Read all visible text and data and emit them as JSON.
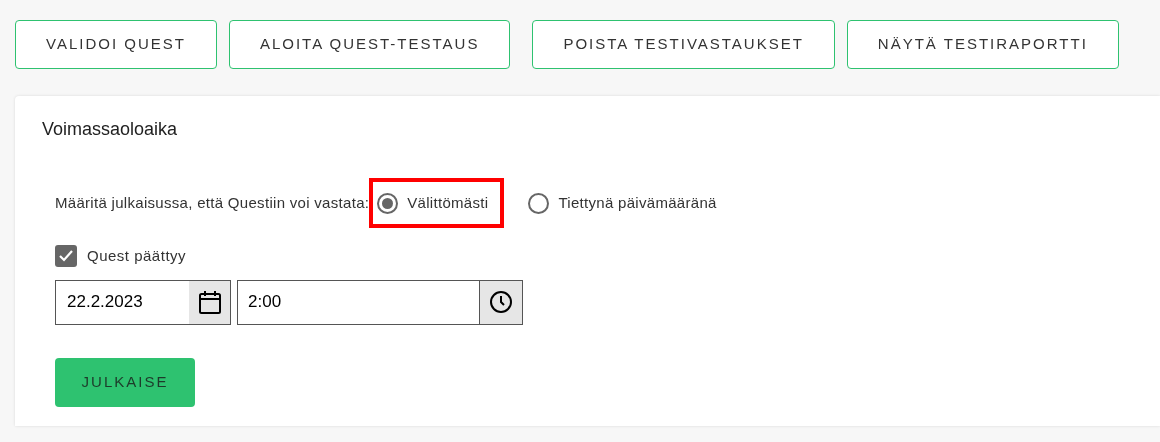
{
  "toolbar": {
    "groups": [
      [
        "VALIDOI QUEST",
        "ALOITA QUEST-TESTAUS"
      ],
      [
        "POISTA TESTIVASTAUKSET",
        "NÄYTÄ TESTIRAPORTTI"
      ]
    ]
  },
  "card": {
    "title": "Voimassaoloaika",
    "publish_prompt": "Määritä julkaisussa, että Questiin voi vastata:",
    "options": [
      {
        "label": "Välittömästi",
        "selected": true,
        "highlighted": true
      },
      {
        "label": "Tiettynä päivämääränä",
        "selected": false,
        "highlighted": false
      }
    ],
    "end_checkbox": {
      "label": "Quest päättyy",
      "checked": true
    },
    "date_field": {
      "value": "22.2.2023"
    },
    "time_field": {
      "value": "2:00"
    },
    "publish_button": "JULKAISE"
  }
}
